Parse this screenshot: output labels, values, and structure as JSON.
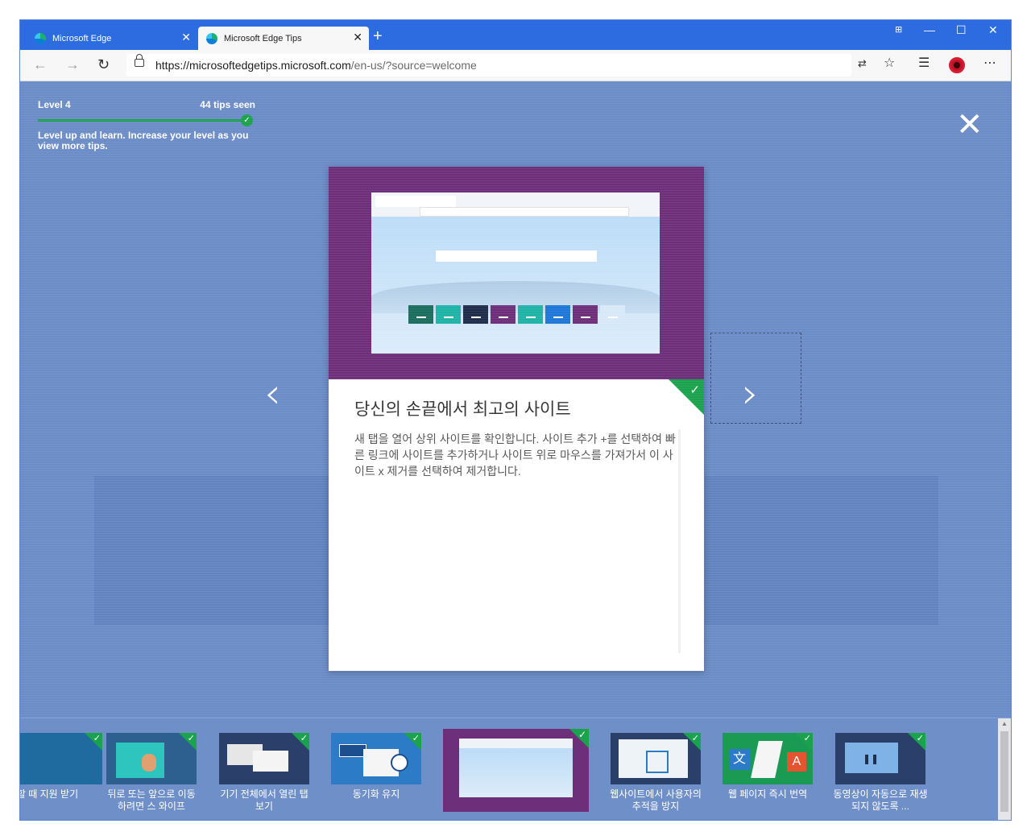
{
  "tabs": [
    {
      "label": "Microsoft Edge",
      "active": false
    },
    {
      "label": "Microsoft Edge Tips",
      "active": true
    }
  ],
  "address": {
    "host": "https://microsoftedgetips.microsoft.com",
    "path": "/en-us/?source=welcome"
  },
  "window_controls": {
    "minimize": "—",
    "maximize": "☐",
    "close": "✕"
  },
  "progress": {
    "level": "Level 4",
    "tips_seen": "44 tips seen",
    "description": "Level up and learn. Increase your level as you view more tips."
  },
  "card": {
    "title": "당신의 손끝에서 최고의 사이트",
    "body": "새 탭을 열어 상위 사이트를 확인합니다. 사이트 추가 +를 선택하여 빠른 링크에 사이트를 추가하거나 사이트 위로 마우스를 가져가서 이 사이트 x 제거를 선택하여 제거합니다."
  },
  "tip_strip": [
    {
      "label": "할 때 지원 받기"
    },
    {
      "label": "뒤로 또는 앞으로 이동하려면 스 와이프"
    },
    {
      "label": "기기 전체에서 열린 탭 보기"
    },
    {
      "label": "동기화 유지"
    },
    {
      "label": ""
    },
    {
      "label": "웹사이트에서 사용자의 추적을 방지"
    },
    {
      "label": "웹 페이지 즉시 번역"
    },
    {
      "label": "동영상이 자동으로 재생되지 않도록 ..."
    }
  ],
  "colors": {
    "accent_green": "#1aa24d",
    "tip_purple": "#6e2f7a",
    "edge_blue": "#2c6be0"
  }
}
